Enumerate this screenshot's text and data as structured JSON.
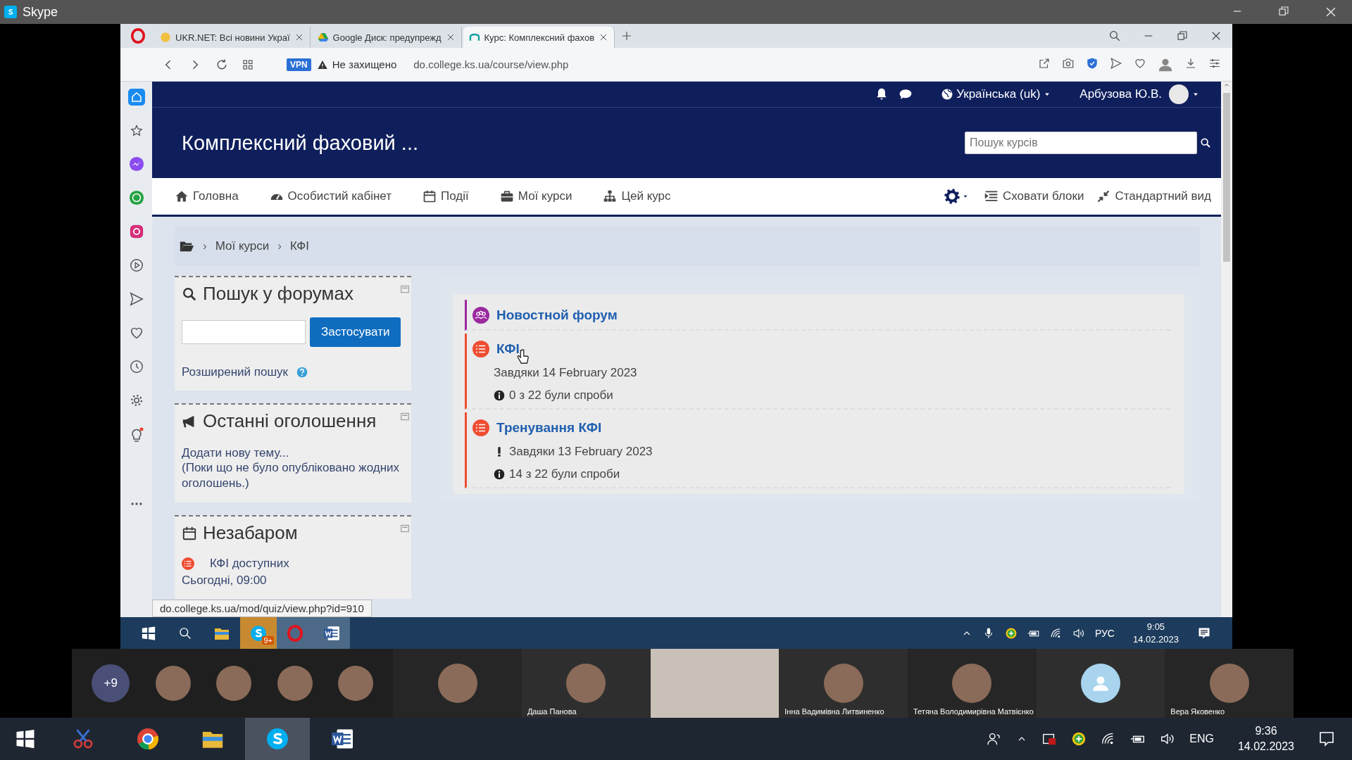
{
  "window": {
    "title": "Skype"
  },
  "browser": {
    "tabs": [
      {
        "label": "UKR.NET: Всі новини Украї",
        "selected": false
      },
      {
        "label": "Google Диск: предупрежд",
        "selected": false
      },
      {
        "label": "Курс: Комплексний фахов",
        "selected": true
      }
    ],
    "vpn": "VPN",
    "security": "Не захищено",
    "url": "do.college.ks.ua/course/view.php",
    "status_url": "do.college.ks.ua/mod/quiz/view.php?id=910"
  },
  "moodle": {
    "language": "Українська (uk)",
    "user": "Арбузова Ю.В.",
    "course_title": "Комплексний фаховий ...",
    "search": {
      "placeholder": "Пошук курсів"
    },
    "nav": [
      {
        "label": "Головна"
      },
      {
        "label": "Особистий кабінет"
      },
      {
        "label": "Події"
      },
      {
        "label": "Мої курси"
      },
      {
        "label": "Цей курс"
      }
    ],
    "nav_right": [
      {
        "label": "Сховати блоки"
      },
      {
        "label": "Стандартний вид"
      }
    ],
    "breadcrumb": [
      {
        "separator": "›",
        "label": "Мої курси"
      },
      {
        "separator": "›",
        "label": "КФІ"
      }
    ],
    "forum_search": {
      "title": "Пошук у форумах",
      "button": "Застосувати",
      "link": "Розширений пошук"
    },
    "announcements": {
      "title": "Останні оголошення",
      "link": "Додати нову тему...",
      "note": "(Поки що не було опубліковано жодних оголошень.)"
    },
    "upcoming": {
      "title": "Незабаром",
      "event": "КФІ доступних",
      "time": "Сьогодні, 09:00"
    },
    "activities": [
      {
        "kind": "forum",
        "title": "Новостной форум"
      },
      {
        "kind": "quiz",
        "title": "КФІ",
        "details": [
          {
            "kind": "date",
            "text": "Завдяки 14 February 2023"
          },
          {
            "kind": "info",
            "text": "0 з 22 були спроби"
          }
        ]
      },
      {
        "kind": "quiz",
        "title": "Тренування КФІ",
        "details": [
          {
            "kind": "warning",
            "text": "Завдяки 13 February 2023"
          },
          {
            "kind": "info",
            "text": "14 з 22 були спроби"
          }
        ]
      }
    ]
  },
  "remote_taskbar": {
    "skype_badge": "9+",
    "language": "РУС",
    "time": "9:05",
    "date": "14.02.2023"
  },
  "participants": {
    "more": "+9",
    "gallery": [
      {
        "kind": "avatar"
      },
      {
        "kind": "avatar"
      },
      {
        "kind": "avatar"
      },
      {
        "kind": "avatar"
      }
    ],
    "tiles": [
      {
        "kind": "avatar"
      },
      {
        "kind": "avatar",
        "name": "Даша Панова"
      },
      {
        "kind": "video"
      },
      {
        "kind": "avatar",
        "name": "Інна Вадимівна Литвиненко"
      },
      {
        "kind": "avatar",
        "name": "Тетяна Володимирівна Матвієнко"
      },
      {
        "kind": "default"
      },
      {
        "kind": "avatar",
        "name": "Вера Яковенко"
      }
    ]
  },
  "taskbar": {
    "language": "ENG",
    "time": "9:36",
    "date": "14.02.2023"
  }
}
